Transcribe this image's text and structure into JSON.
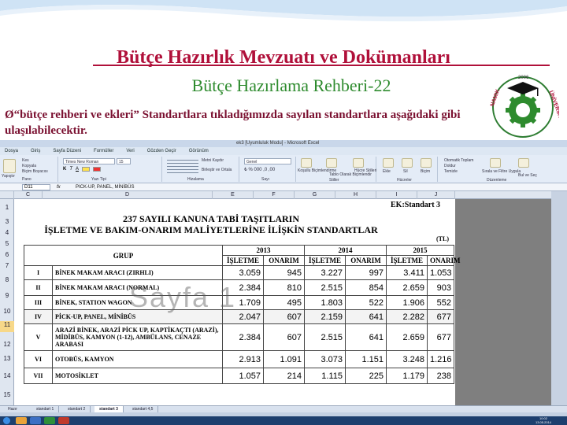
{
  "slide": {
    "title": "Bütçe Hazırlık Mevzuatı ve Dokümanları",
    "subtitle": "Bütçe Hazırlama Rehberi-22",
    "bullet_arrow": "Ø",
    "bullet_text": "“bütçe rehberi ve ekleri” Standartlara tıkladığımızda sayılan standartlara aşağıdaki gibi ulaşılabilecektir.",
    "logo_text_left": "NAMIK",
    "logo_text_right": "ÜNİVERSİTESİ",
    "logo_year": "2006"
  },
  "excel": {
    "window_title": "ek3 [Uyumluluk Modu] - Microsoft Excel",
    "menu": [
      "Dosya",
      "Giriş",
      "Sayfa Düzeni",
      "Formüller",
      "Veri",
      "Gözden Geçir",
      "Görünüm"
    ],
    "ribbon": {
      "cut": "Kes",
      "copy": "Kopyala",
      "format_painter": "Biçim Boyacısı",
      "paste": "Yapıştır",
      "clipboard_group": "Pano",
      "font_name": "Times New Roman",
      "font_size": "15",
      "font_group": "Yazı Tipi",
      "wrap_text": "Metni Kaydır",
      "merge_center": "Birleştir ve Ortala",
      "alignment_group": "Hizalama",
      "number_format": "Genel",
      "number_group": "Sayı",
      "conditional_format": "Koşullu Biçimlendirme",
      "format_as_table": "Tablo Olarak Biçimlendir",
      "cell_styles": "Hücre Stilleri",
      "styles_group": "Stiller",
      "insert": "Ekle",
      "delete": "Sil",
      "format": "Biçim",
      "cells_group": "Hücreler",
      "autosum": "Otomatik Toplam",
      "fill": "Doldur",
      "clear": "Temizle",
      "sort_filter": "Sırala ve Filtre Uygula",
      "find_select": "Bul ve Seç",
      "editing_group": "Düzenleme"
    },
    "name_box": "D11",
    "formula_content": "PICK-UP, PANEL, MİNİBÜS",
    "columns": [
      "C",
      "D",
      "E",
      "F",
      "G",
      "H",
      "I",
      "J"
    ],
    "row_numbers": [
      "1",
      "3",
      "4",
      "5",
      "6",
      "7",
      "8",
      "9",
      "10",
      "11",
      "12",
      "13",
      "14",
      "15"
    ],
    "selected_row": "11",
    "ek_label": "EK:Standart 3",
    "doc_title_1": "237 SAYILI KANUNA TABİ TAŞITLARIN",
    "doc_title_2": "İŞLETME VE BAKIM-ONARIM MALİYETLERİNE İLİŞKİN STANDARTLAR",
    "currency_note": "(TL)",
    "group_header": "GRUP",
    "years": [
      "2013",
      "2014",
      "2015"
    ],
    "sub_headers": [
      "İŞLETME",
      "ONARIM",
      "İŞLETME",
      "ONARIM",
      "İŞLETME",
      "ONARIM"
    ],
    "rows": [
      {
        "no": "I",
        "name": "BİNEK MAKAM ARACI   (ZIRHLI)",
        "vals": [
          "3.059",
          "945",
          "3.227",
          "997",
          "3.411",
          "1.053"
        ]
      },
      {
        "no": "II",
        "name": "BİNEK MAKAM ARACI   (NORMAL)",
        "vals": [
          "2.384",
          "810",
          "2.515",
          "854",
          "2.659",
          "903"
        ]
      },
      {
        "no": "III",
        "name": "BİNEK, STATION WAGON",
        "vals": [
          "1.709",
          "495",
          "1.803",
          "522",
          "1.906",
          "552"
        ]
      },
      {
        "no": "IV",
        "name": "PİCK-UP, PANEL, MİNİBÜS",
        "vals": [
          "2.047",
          "607",
          "2.159",
          "641",
          "2.282",
          "677"
        ]
      },
      {
        "no": "V",
        "name": "ARAZİ BİNEK, ARAZİ PİCK UP, KAPTİKAÇTI (ARAZİ), MİDİBÜS, KAMYON (1-12), AMBÜLANS, CENAZE ARABASI",
        "vals": [
          "2.384",
          "607",
          "2.515",
          "641",
          "2.659",
          "677"
        ]
      },
      {
        "no": "VI",
        "name": "OTOBÜS, KAMYON",
        "vals": [
          "2.913",
          "1.091",
          "3.073",
          "1.151",
          "3.248",
          "1.216"
        ]
      },
      {
        "no": "VII",
        "name": "MOTOSİKLET",
        "vals": [
          "1.057",
          "214",
          "1.115",
          "225",
          "1.179",
          "238"
        ]
      }
    ],
    "watermark": "Sayfa 1",
    "sheet_tabs": [
      "Hazır",
      "standart 1",
      "standart 2",
      "standart 3",
      "standart 4,5"
    ],
    "active_sheet": "standart 3",
    "clock_time": "10:02",
    "clock_date": "13.05.2014"
  }
}
